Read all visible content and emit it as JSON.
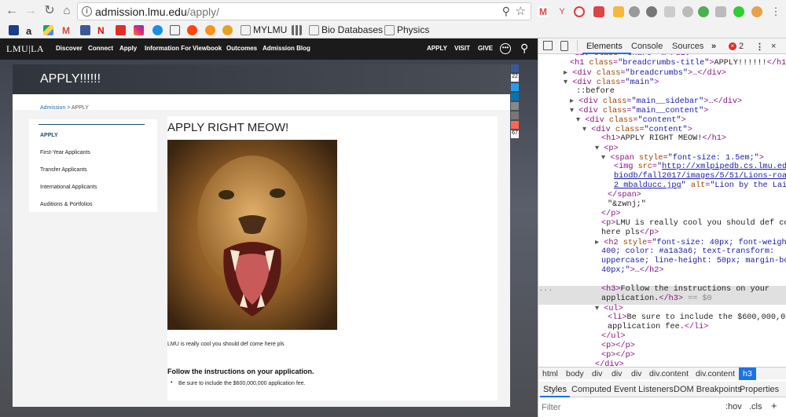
{
  "browser": {
    "url_host": "admission.lmu.edu",
    "url_path": "/apply/"
  },
  "bookmarks": [
    {
      "label": "MYLMU"
    },
    {
      "label": "Bio Databases"
    },
    {
      "label": "Physics"
    }
  ],
  "site": {
    "logo": "LMU|LA",
    "nav": [
      "Discover",
      "Connect",
      "Apply",
      "Information For",
      "Viewbook",
      "Outcomes",
      "Admission Blog"
    ],
    "nav_right": [
      "APPLY",
      "VISIT",
      "GIVE"
    ],
    "hero_title": "APPLY!!!!!!",
    "breadcrumb_link": "Admission",
    "breadcrumb_sep": " > ",
    "breadcrumb_current": "APPLY",
    "sidebar": [
      "APPLY",
      "First-Year Applicants",
      "Transfer Applicants",
      "International Applicants",
      "Auditions & Portfolios"
    ],
    "content_title": "APPLY RIGHT MEOW!",
    "image_alt": "Lion by the Lair",
    "paragraph": "LMU is really cool you should def come here pls",
    "instructions_heading": "Follow the instructions on your application.",
    "list_item": "Be sure to include the $600,000,000 application fee.",
    "share_counts": [
      "22",
      "67"
    ]
  },
  "devtools": {
    "tabs": [
      "Elements",
      "Console",
      "Sources"
    ],
    "error_count": "2",
    "crumbs": [
      "html",
      "body",
      "div",
      "div",
      "div",
      "div.content",
      "div.content",
      "h3"
    ],
    "styles_tabs": [
      "Styles",
      "Computed",
      "Event Listeners",
      "DOM Breakpoints",
      "Properties"
    ],
    "filter_placeholder": "Filter",
    "filter_hov": ":hov",
    "filter_cls": ".cls",
    "selected_eq": "== $0"
  },
  "colors": {
    "site_nav": "#1b1b1b",
    "devtools_selected": "#1a73e8",
    "link": "#1a1aa6"
  }
}
